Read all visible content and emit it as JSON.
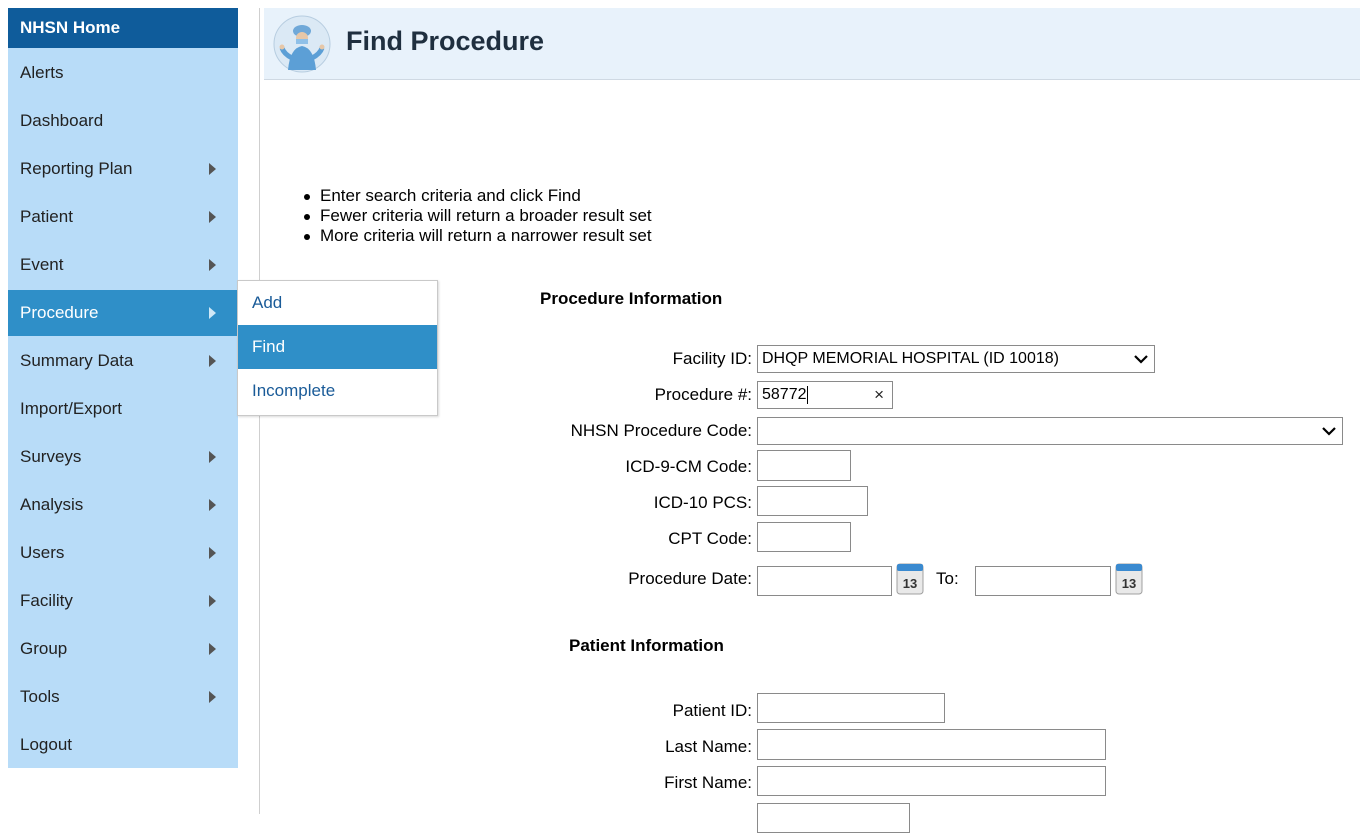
{
  "sidebar": {
    "items": [
      {
        "label": "NHSN Home",
        "arrow": false
      },
      {
        "label": "Alerts",
        "arrow": false
      },
      {
        "label": "Dashboard",
        "arrow": false
      },
      {
        "label": "Reporting Plan",
        "arrow": true
      },
      {
        "label": "Patient",
        "arrow": true
      },
      {
        "label": "Event",
        "arrow": true
      },
      {
        "label": "Procedure",
        "arrow": true
      },
      {
        "label": "Summary Data",
        "arrow": true
      },
      {
        "label": "Import/Export",
        "arrow": false
      },
      {
        "label": "Surveys",
        "arrow": true
      },
      {
        "label": "Analysis",
        "arrow": true
      },
      {
        "label": "Users",
        "arrow": true
      },
      {
        "label": "Facility",
        "arrow": true
      },
      {
        "label": "Group",
        "arrow": true
      },
      {
        "label": "Tools",
        "arrow": true
      },
      {
        "label": "Logout",
        "arrow": false
      }
    ],
    "active": "Procedure"
  },
  "flyout": {
    "items": [
      {
        "label": "Add"
      },
      {
        "label": "Find"
      },
      {
        "label": "Incomplete"
      }
    ],
    "active": "Find"
  },
  "header": {
    "title": "Find Procedure"
  },
  "instructions": [
    "Enter search criteria and click Find",
    "Fewer criteria will return a broader result set",
    "More criteria will return a narrower result set"
  ],
  "procedure_section": {
    "title": "Procedure Information",
    "facility_label": "Facility ID:",
    "facility_value": "DHQP MEMORIAL HOSPITAL (ID 10018)",
    "procedure_num_label": "Procedure #:",
    "procedure_num_value": "58772",
    "procedure_num_clear": "×",
    "nhsn_code_label": "NHSN Procedure Code:",
    "nhsn_code_value": "",
    "icd9_label": "ICD-9-CM Code:",
    "icd10_label": "ICD-10 PCS:",
    "cpt_label": "CPT Code:",
    "date_label": "Procedure Date:",
    "to_label": "To:",
    "calendar_day": "13"
  },
  "patient_section": {
    "title": "Patient Information",
    "patient_id_label": "Patient ID:",
    "last_name_label": "Last Name:",
    "first_name_label": "First Name:"
  },
  "colors": {
    "home_bg": "#0f5c9b",
    "nav_bg": "#b8dcf8",
    "active_bg": "#2f8fc8",
    "header_bg": "#e8f2fb",
    "link": "#1a5b98"
  }
}
